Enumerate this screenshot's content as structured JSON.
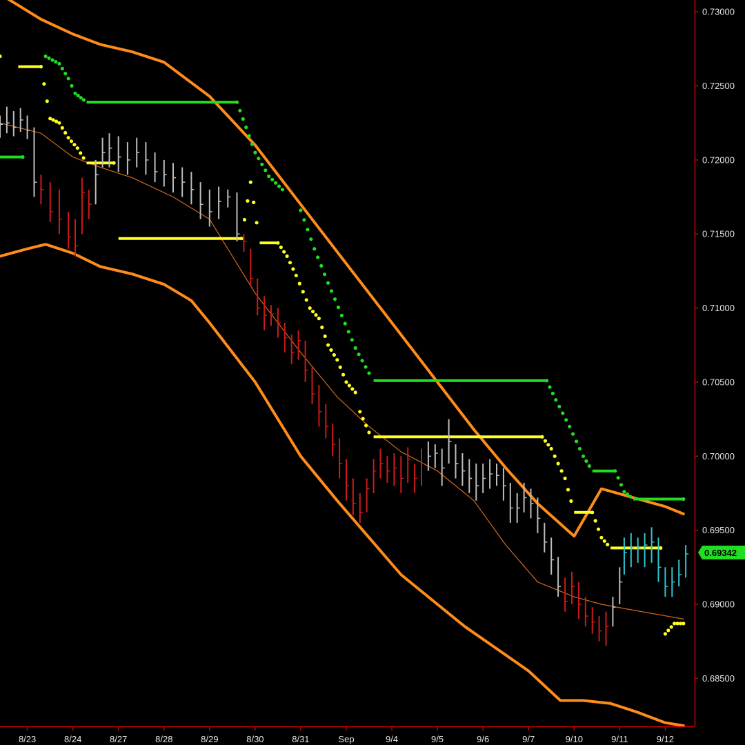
{
  "colors": {
    "background": "#000000",
    "axis": "#cc0000",
    "band": "#ff8c1a",
    "midline": "#d2691e",
    "upper_trail": "#22dd22",
    "lower_trail": "#ffff22",
    "bar_down": "#cc1a1a",
    "bar_neutral": "#bdbdbd",
    "bar_up": "#2fc6cf",
    "price_tag_bg": "#22dd22"
  },
  "chart_data": {
    "type": "line",
    "title": "",
    "xlabel": "",
    "ylabel": "",
    "ylim": [
      0.6818,
      0.7308
    ],
    "yticks": [
      "0.73000",
      "0.72500",
      "0.72000",
      "0.71500",
      "0.71000",
      "0.70500",
      "0.70000",
      "0.69500",
      "0.69000",
      "0.68500"
    ],
    "xticks": [
      "8/23",
      "8/24",
      "8/27",
      "8/28",
      "8/29",
      "8/30",
      "8/31",
      "Sep",
      "9/4",
      "9/5",
      "9/6",
      "9/7",
      "9/10",
      "9/11",
      "9/12"
    ],
    "xlim": [
      -0.6,
      14.6
    ],
    "last_price": "0.69342",
    "grid": false,
    "series": [
      {
        "type": "band_upper",
        "x": [
          -0.6,
          0.3,
          1.0,
          1.6,
          2.3,
          3.0,
          4.0,
          5.0,
          6.0,
          7.0,
          8.0,
          9.0,
          9.8,
          10.5,
          11.2,
          12.0,
          12.6,
          13.3,
          14.0,
          14.4
        ],
        "y": [
          0.7312,
          0.7295,
          0.7285,
          0.7278,
          0.7273,
          0.7266,
          0.7243,
          0.721,
          0.717,
          0.713,
          0.709,
          0.705,
          0.7018,
          0.6992,
          0.6968,
          0.6946,
          0.6978,
          0.6972,
          0.6966,
          0.6961
        ]
      },
      {
        "type": "band_lower",
        "x": [
          -0.6,
          0.0,
          0.4,
          1.0,
          1.6,
          2.3,
          3.0,
          3.6,
          4.0,
          5.0,
          6.0,
          6.8,
          7.5,
          8.2,
          9.0,
          9.6,
          10.3,
          11.0,
          11.7,
          12.2,
          12.8,
          13.4,
          14.0,
          14.4
        ],
        "y": [
          0.7135,
          0.714,
          0.7143,
          0.7137,
          0.7128,
          0.7123,
          0.7116,
          0.7105,
          0.709,
          0.705,
          0.7,
          0.697,
          0.6945,
          0.692,
          0.69,
          0.6885,
          0.687,
          0.6855,
          0.6835,
          0.6835,
          0.6833,
          0.6827,
          0.682,
          0.6818
        ]
      },
      {
        "type": "midline",
        "x": [
          -0.6,
          0.3,
          1.0,
          1.6,
          2.3,
          3.2,
          4.0,
          5.0,
          6.0,
          6.8,
          7.5,
          8.2,
          9.0,
          9.8,
          10.5,
          11.2,
          12.0,
          12.6,
          13.3,
          14.4
        ],
        "y": [
          0.7225,
          0.7218,
          0.7202,
          0.7195,
          0.7188,
          0.7175,
          0.716,
          0.711,
          0.707,
          0.704,
          0.702,
          0.7003,
          0.699,
          0.697,
          0.694,
          0.6915,
          0.6905,
          0.69,
          0.6896,
          0.689
        ]
      },
      {
        "type": "upper_trail",
        "points": [
          [
            -0.6,
            0.7202
          ],
          [
            -0.1,
            0.7202
          ],
          [
            0.4,
            0.727
          ],
          [
            0.7,
            0.7265
          ],
          [
            0.9,
            0.7255
          ],
          [
            1.05,
            0.7245
          ],
          [
            1.3,
            0.7239
          ],
          [
            4.6,
            0.7239
          ],
          [
            4.8,
            0.7222
          ],
          [
            5.0,
            0.7205
          ],
          [
            5.3,
            0.7189
          ],
          [
            5.6,
            0.718
          ],
          [
            6.0,
            0.7166
          ],
          [
            6.3,
            0.714
          ],
          [
            6.6,
            0.7117
          ],
          [
            6.9,
            0.7095
          ],
          [
            7.2,
            0.7073
          ],
          [
            7.5,
            0.7056
          ],
          [
            7.6,
            0.7051
          ],
          [
            11.4,
            0.7051
          ],
          [
            11.6,
            0.7038
          ],
          [
            11.9,
            0.702
          ],
          [
            12.2,
            0.7
          ],
          [
            12.4,
            0.699
          ],
          [
            12.9,
            0.699
          ],
          [
            13.1,
            0.6976
          ],
          [
            13.3,
            0.6971
          ],
          [
            14.4,
            0.6971
          ]
        ]
      },
      {
        "type": "lower_trail",
        "points": [
          [
            -0.6,
            0.727
          ],
          [
            -0.2,
            0.7263
          ],
          [
            0.3,
            0.7263
          ],
          [
            0.5,
            0.7228
          ],
          [
            0.7,
            0.7225
          ],
          [
            0.9,
            0.7215
          ],
          [
            1.1,
            0.7208
          ],
          [
            1.3,
            0.7198
          ],
          [
            1.9,
            0.7198
          ],
          [
            2.0,
            0.7147
          ],
          [
            4.7,
            0.7147
          ],
          [
            4.9,
            0.7185
          ],
          [
            5.1,
            0.7144
          ],
          [
            5.5,
            0.7144
          ],
          [
            5.7,
            0.7135
          ],
          [
            5.9,
            0.7122
          ],
          [
            6.2,
            0.71
          ],
          [
            6.4,
            0.7093
          ],
          [
            6.6,
            0.7075
          ],
          [
            6.8,
            0.7065
          ],
          [
            7.0,
            0.705
          ],
          [
            7.2,
            0.7043
          ],
          [
            7.3,
            0.703
          ],
          [
            7.5,
            0.7016
          ],
          [
            7.6,
            0.7013
          ],
          [
            11.3,
            0.7013
          ],
          [
            11.5,
            0.7005
          ],
          [
            11.8,
            0.6985
          ],
          [
            12.0,
            0.6962
          ],
          [
            12.4,
            0.6962
          ],
          [
            12.6,
            0.6945
          ],
          [
            12.8,
            0.6938
          ],
          [
            13.9,
            0.6938
          ],
          [
            14.0,
            0.688
          ],
          [
            14.2,
            0.6887
          ],
          [
            14.4,
            0.6887
          ]
        ]
      },
      {
        "type": "price_bars",
        "state_legend": {
          "d": "down",
          "n": "neutral",
          "u": "up"
        },
        "bars": [
          [
            -0.6,
            0.7215,
            0.723,
            0.7224,
            "n"
          ],
          [
            -0.45,
            0.7218,
            0.7236,
            0.7225,
            "n"
          ],
          [
            -0.3,
            0.7216,
            0.7233,
            0.7222,
            "n"
          ],
          [
            -0.15,
            0.7219,
            0.7235,
            0.7227,
            "n"
          ],
          [
            0.0,
            0.7214,
            0.723,
            0.722,
            "n"
          ],
          [
            0.15,
            0.7175,
            0.7222,
            0.7185,
            "n"
          ],
          [
            0.3,
            0.717,
            0.719,
            0.718,
            "d"
          ],
          [
            0.5,
            0.7158,
            0.7185,
            0.7165,
            "d"
          ],
          [
            0.7,
            0.715,
            0.718,
            0.716,
            "d"
          ],
          [
            0.9,
            0.714,
            0.7165,
            0.7148,
            "d"
          ],
          [
            1.05,
            0.7135,
            0.716,
            0.7142,
            "d"
          ],
          [
            1.2,
            0.715,
            0.7188,
            0.7178,
            "d"
          ],
          [
            1.35,
            0.716,
            0.718,
            0.717,
            "d"
          ],
          [
            1.5,
            0.717,
            0.72,
            0.719,
            "n"
          ],
          [
            1.65,
            0.7195,
            0.7215,
            0.7205,
            "n"
          ],
          [
            1.8,
            0.7195,
            0.7218,
            0.7208,
            "n"
          ],
          [
            2.0,
            0.7192,
            0.7216,
            0.7202,
            "n"
          ],
          [
            2.2,
            0.719,
            0.7212,
            0.72,
            "n"
          ],
          [
            2.4,
            0.7195,
            0.7215,
            0.7205,
            "n"
          ],
          [
            2.6,
            0.719,
            0.7212,
            0.72,
            "n"
          ],
          [
            2.8,
            0.7185,
            0.7205,
            0.7192,
            "n"
          ],
          [
            3.0,
            0.7182,
            0.72,
            0.719,
            "n"
          ],
          [
            3.2,
            0.7178,
            0.7198,
            0.7188,
            "n"
          ],
          [
            3.4,
            0.7175,
            0.7195,
            0.7185,
            "n"
          ],
          [
            3.6,
            0.717,
            0.7192,
            0.718,
            "n"
          ],
          [
            3.8,
            0.716,
            0.7185,
            0.717,
            "n"
          ],
          [
            4.0,
            0.7155,
            0.718,
            0.7165,
            "n"
          ],
          [
            4.2,
            0.716,
            0.7182,
            0.7172,
            "n"
          ],
          [
            4.4,
            0.7168,
            0.718,
            0.7175,
            "n"
          ],
          [
            4.6,
            0.7145,
            0.7178,
            0.715,
            "n"
          ],
          [
            4.75,
            0.7138,
            0.715,
            0.7145,
            "d"
          ],
          [
            4.9,
            0.7115,
            0.714,
            0.712,
            "d"
          ],
          [
            5.05,
            0.7095,
            0.712,
            0.71,
            "d"
          ],
          [
            5.2,
            0.7085,
            0.7108,
            0.7095,
            "d"
          ],
          [
            5.35,
            0.7088,
            0.7102,
            0.7096,
            "d"
          ],
          [
            5.5,
            0.708,
            0.71,
            0.709,
            "d"
          ],
          [
            5.65,
            0.707,
            0.709,
            0.708,
            "d"
          ],
          [
            5.8,
            0.7062,
            0.7082,
            0.707,
            "d"
          ],
          [
            5.95,
            0.7065,
            0.7085,
            0.7078,
            "d"
          ],
          [
            6.1,
            0.705,
            0.7078,
            0.7058,
            "d"
          ],
          [
            6.25,
            0.7035,
            0.706,
            0.7042,
            "d"
          ],
          [
            6.4,
            0.702,
            0.7048,
            0.703,
            "d"
          ],
          [
            6.55,
            0.7012,
            0.7035,
            0.702,
            "d"
          ],
          [
            6.7,
            0.7,
            0.7022,
            0.7008,
            "d"
          ],
          [
            6.85,
            0.6985,
            0.7012,
            0.6995,
            "d"
          ],
          [
            7.0,
            0.697,
            0.6998,
            0.698,
            "d"
          ],
          [
            7.15,
            0.696,
            0.6985,
            0.6968,
            "d"
          ],
          [
            7.3,
            0.6955,
            0.6975,
            0.6962,
            "d"
          ],
          [
            7.45,
            0.6962,
            0.6985,
            0.6978,
            "d"
          ],
          [
            7.6,
            0.6975,
            0.6998,
            0.699,
            "d"
          ],
          [
            7.75,
            0.6985,
            0.7005,
            0.6995,
            "d"
          ],
          [
            7.9,
            0.6982,
            0.7,
            0.699,
            "d"
          ],
          [
            8.05,
            0.698,
            0.7002,
            0.6992,
            "d"
          ],
          [
            8.2,
            0.6975,
            0.7,
            0.6985,
            "d"
          ],
          [
            8.35,
            0.6982,
            0.7006,
            0.6998,
            "d"
          ],
          [
            8.5,
            0.6975,
            0.6995,
            0.6985,
            "d"
          ],
          [
            8.65,
            0.698,
            0.7005,
            0.6995,
            "d"
          ],
          [
            8.8,
            0.699,
            0.701,
            0.7,
            "n"
          ],
          [
            8.95,
            0.6992,
            0.7008,
            0.7002,
            "n"
          ],
          [
            9.1,
            0.698,
            0.7005,
            0.6992,
            "n"
          ],
          [
            9.25,
            0.6995,
            0.7025,
            0.701,
            "n"
          ],
          [
            9.4,
            0.6985,
            0.7008,
            0.6995,
            "n"
          ],
          [
            9.55,
            0.698,
            0.7002,
            0.699,
            "n"
          ],
          [
            9.7,
            0.6975,
            0.6998,
            0.6985,
            "n"
          ],
          [
            9.85,
            0.697,
            0.6995,
            0.698,
            "n"
          ],
          [
            10.0,
            0.6975,
            0.6995,
            0.6985,
            "n"
          ],
          [
            10.15,
            0.6978,
            0.6998,
            0.6988,
            "n"
          ],
          [
            10.3,
            0.698,
            0.6995,
            0.6987,
            "n"
          ],
          [
            10.45,
            0.697,
            0.6992,
            0.698,
            "n"
          ],
          [
            10.6,
            0.6955,
            0.6982,
            0.6965,
            "n"
          ],
          [
            10.75,
            0.6955,
            0.6975,
            0.6965,
            "n"
          ],
          [
            10.9,
            0.6962,
            0.6982,
            0.6972,
            "n"
          ],
          [
            11.05,
            0.6958,
            0.6978,
            0.6968,
            "n"
          ],
          [
            11.2,
            0.6948,
            0.6972,
            0.6958,
            "n"
          ],
          [
            11.35,
            0.6935,
            0.6955,
            0.6942,
            "n"
          ],
          [
            11.5,
            0.692,
            0.6945,
            0.693,
            "n"
          ],
          [
            11.65,
            0.6905,
            0.6932,
            0.6912,
            "n"
          ],
          [
            11.8,
            0.6895,
            0.6918,
            0.6902,
            "d"
          ],
          [
            11.95,
            0.69,
            0.6922,
            0.6912,
            "d"
          ],
          [
            12.1,
            0.689,
            0.6915,
            0.69,
            "d"
          ],
          [
            12.25,
            0.6885,
            0.6905,
            0.6892,
            "d"
          ],
          [
            12.4,
            0.688,
            0.6898,
            0.6888,
            "d"
          ],
          [
            12.55,
            0.6875,
            0.6892,
            0.6882,
            "d"
          ],
          [
            12.7,
            0.6872,
            0.6895,
            0.6885,
            "d"
          ],
          [
            12.85,
            0.6885,
            0.6905,
            0.6898,
            "n"
          ],
          [
            13.0,
            0.69,
            0.6925,
            0.6915,
            "n"
          ],
          [
            13.1,
            0.692,
            0.6945,
            0.6935,
            "u"
          ],
          [
            13.25,
            0.6925,
            0.6948,
            0.6938,
            "u"
          ],
          [
            13.4,
            0.6928,
            0.6945,
            0.6938,
            "u"
          ],
          [
            13.55,
            0.6925,
            0.6948,
            0.694,
            "u"
          ],
          [
            13.7,
            0.6928,
            0.6952,
            0.6942,
            "u"
          ],
          [
            13.85,
            0.6915,
            0.6945,
            0.6925,
            "u"
          ],
          [
            14.0,
            0.6905,
            0.6925,
            0.6912,
            "u"
          ],
          [
            14.15,
            0.6905,
            0.6925,
            0.6915,
            "u"
          ],
          [
            14.3,
            0.6912,
            0.693,
            0.692,
            "u"
          ],
          [
            14.45,
            0.6918,
            0.694,
            0.6934,
            "u"
          ]
        ]
      }
    ]
  }
}
